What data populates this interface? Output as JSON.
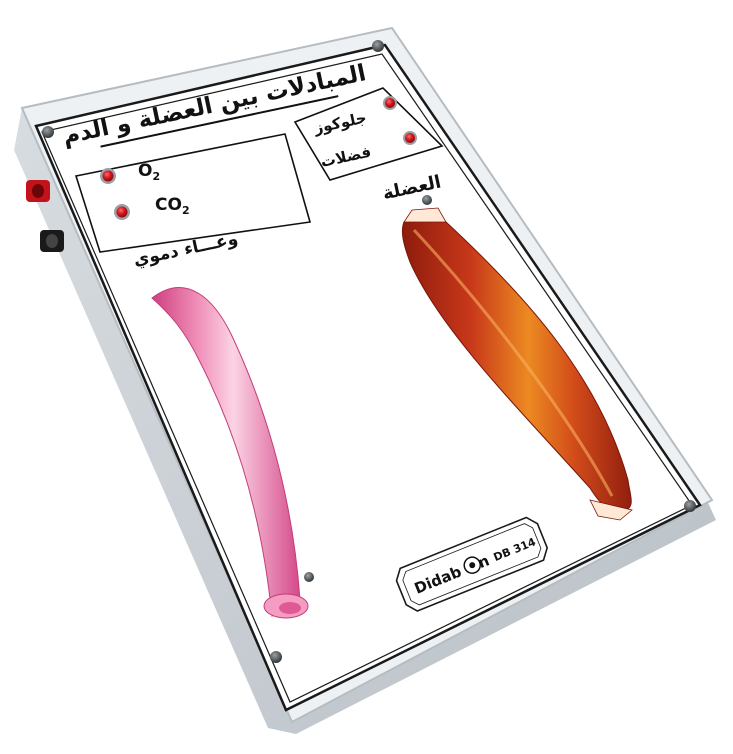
{
  "title": "المبادلات بين العضلة و الدم",
  "labels": {
    "glucose": "جلوكوز",
    "waste": "فضلات",
    "o2": "O",
    "o2_sub": "2",
    "co2": "CO",
    "co2_sub": "2",
    "muscle": "العضلة",
    "vessel": "وعـــاء دموي"
  },
  "brand": {
    "name": "Didab",
    "name_tail": "n",
    "model": "DB 314"
  },
  "colors": {
    "case": "#e9ecee",
    "panel": "#ffffff",
    "led": "#c8141c",
    "terminal_red": "#c4121a",
    "terminal_black": "#1a1a1a",
    "vessel": "#e8609a",
    "muscle": "#c83a18"
  }
}
